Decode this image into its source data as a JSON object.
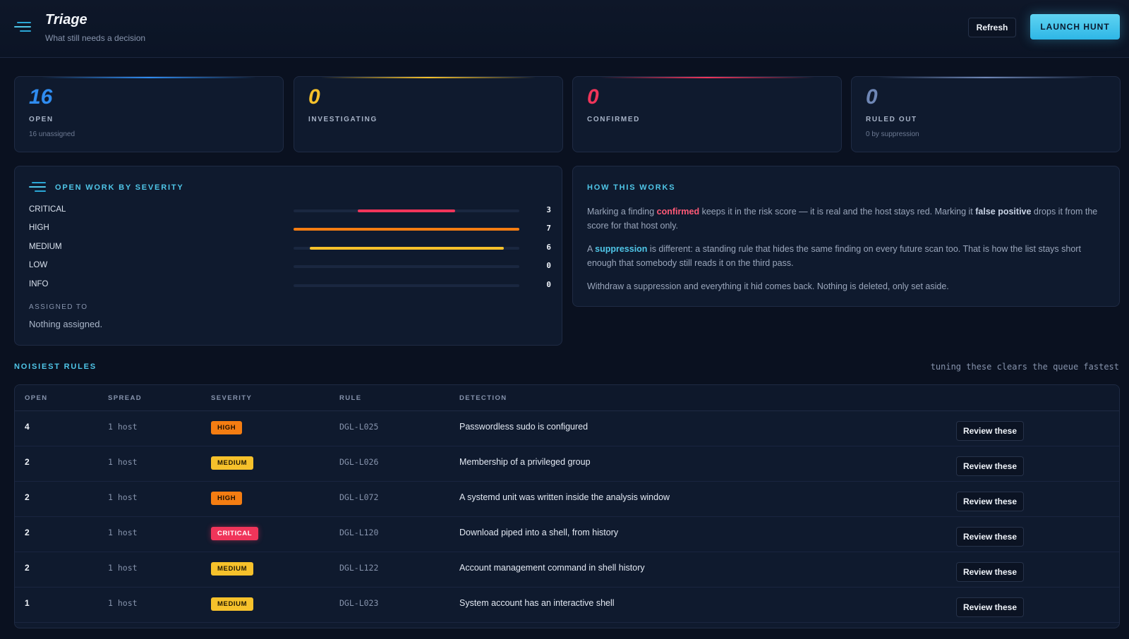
{
  "header": {
    "title": "Triage",
    "subtitle": "What still needs a decision",
    "refresh_label": "Refresh",
    "hunt_label": "LAUNCH HUNT"
  },
  "stats": [
    {
      "value": "16",
      "label": "OPEN",
      "sub": "16 unassigned",
      "color": "#2f8cf0"
    },
    {
      "value": "0",
      "label": "INVESTIGATING",
      "sub": "",
      "color": "#f6c12b"
    },
    {
      "value": "0",
      "label": "CONFIRMED",
      "sub": "",
      "color": "#f0355a"
    },
    {
      "value": "0",
      "label": "RULED OUT",
      "sub": "0 by suppression",
      "color": "#6f87b6"
    }
  ],
  "severity_panel": {
    "title": "OPEN WORK BY SEVERITY",
    "rows": [
      {
        "name": "CRITICAL",
        "count": "3",
        "share": 0.43,
        "color": "#f0355a"
      },
      {
        "name": "HIGH",
        "count": "7",
        "share": 1.0,
        "color": "#f47d12"
      },
      {
        "name": "MEDIUM",
        "count": "6",
        "share": 0.86,
        "color": "#f6c12b"
      },
      {
        "name": "LOW",
        "count": "0",
        "share": 0,
        "color": "#4fc6e8"
      },
      {
        "name": "INFO",
        "count": "0",
        "share": 0,
        "color": "#6f87b6"
      }
    ],
    "assigned_label": "ASSIGNED TO",
    "assigned_value": "Nothing assigned."
  },
  "how": {
    "title": "HOW THIS WORKS",
    "p1": {
      "a": "Marking a finding ",
      "b": "confirmed",
      "c": " keeps it in the risk score — it is real and the host stays red. Marking it ",
      "d": "false positive",
      "e": " drops it from the score for that host only."
    },
    "p2": {
      "a": "A ",
      "b": "suppression",
      "c": " is different: a standing rule that hides the same finding on every future scan too. That is how the list stays short enough that somebody still reads it on the third pass."
    },
    "p3": "Withdraw a suppression and everything it hid comes back. Nothing is deleted, only set aside."
  },
  "noisiest": {
    "title": "NOISIEST RULES",
    "hint": "tuning these clears the queue fastest",
    "columns": [
      "OPEN",
      "SPREAD",
      "SEVERITY",
      "RULE",
      "DETECTION"
    ],
    "review_label": "Review these",
    "rows": [
      {
        "open": "4",
        "spread": "1 host",
        "severity": "HIGH",
        "rule": "DGL-L025",
        "detection": "Passwordless sudo is configured"
      },
      {
        "open": "2",
        "spread": "1 host",
        "severity": "MEDIUM",
        "rule": "DGL-L026",
        "detection": "Membership of a privileged group"
      },
      {
        "open": "2",
        "spread": "1 host",
        "severity": "HIGH",
        "rule": "DGL-L072",
        "detection": "A systemd unit was written inside the analysis window"
      },
      {
        "open": "2",
        "spread": "1 host",
        "severity": "CRITICAL",
        "rule": "DGL-L120",
        "detection": "Download piped into a shell, from history"
      },
      {
        "open": "2",
        "spread": "1 host",
        "severity": "MEDIUM",
        "rule": "DGL-L122",
        "detection": "Account management command in shell history"
      },
      {
        "open": "1",
        "spread": "1 host",
        "severity": "MEDIUM",
        "rule": "DGL-L023",
        "detection": "System account has an interactive shell"
      }
    ]
  }
}
